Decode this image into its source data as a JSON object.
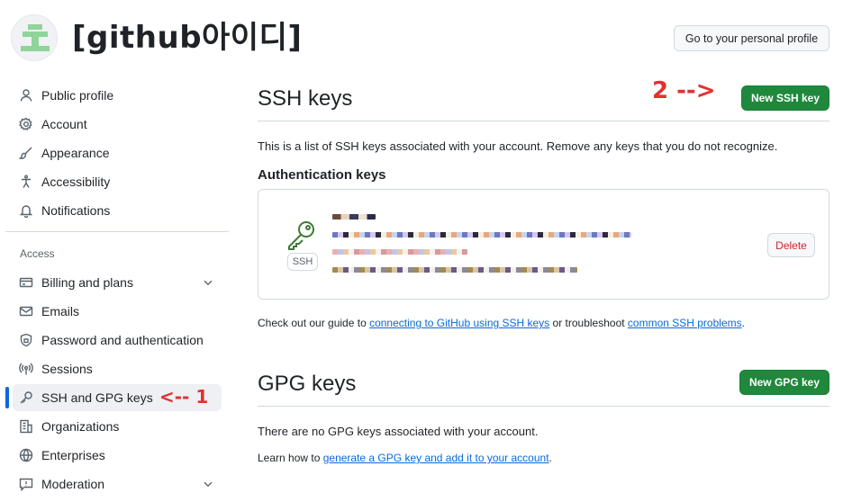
{
  "header": {
    "username": "[github아이디]",
    "profile_button": "Go to your personal profile"
  },
  "sidebar": {
    "section_label": "Access",
    "items": [
      {
        "label": "Public profile",
        "icon": "person-icon"
      },
      {
        "label": "Account",
        "icon": "gear-icon"
      },
      {
        "label": "Appearance",
        "icon": "paintbrush-icon"
      },
      {
        "label": "Accessibility",
        "icon": "accessibility-icon"
      },
      {
        "label": "Notifications",
        "icon": "bell-icon"
      },
      {
        "label": "Billing and plans",
        "icon": "credit-card-icon"
      },
      {
        "label": "Emails",
        "icon": "mail-icon"
      },
      {
        "label": "Password and authentication",
        "icon": "shield-lock-icon"
      },
      {
        "label": "Sessions",
        "icon": "broadcast-icon"
      },
      {
        "label": "SSH and GPG keys",
        "icon": "key-icon"
      },
      {
        "label": "Organizations",
        "icon": "organization-icon"
      },
      {
        "label": "Enterprises",
        "icon": "globe-icon"
      },
      {
        "label": "Moderation",
        "icon": "report-icon"
      }
    ],
    "active_index": 9
  },
  "annotations": {
    "sidebar_arrow": "<-- 1",
    "button_arrow": "2 -->"
  },
  "ssh": {
    "title": "SSH keys",
    "new_button": "New SSH key",
    "description": "This is a list of SSH keys associated with your account. Remove any keys that you do not recognize.",
    "auth_heading": "Authentication keys",
    "key_type_badge": "SSH",
    "delete_button": "Delete",
    "guide_prefix": "Check out our guide to ",
    "guide_link": "connecting to GitHub using SSH keys",
    "guide_middle": " or troubleshoot ",
    "guide_link2": "common SSH problems",
    "guide_suffix": "."
  },
  "gpg": {
    "title": "GPG keys",
    "new_button": "New GPG key",
    "empty_text": "There are no GPG keys associated with your account.",
    "learn_prefix": "Learn how to ",
    "learn_link": "generate a GPG key and add it to your account",
    "learn_suffix": "."
  },
  "colors": {
    "primary_button": "#1f883d",
    "annotation": "#e03131",
    "link": "#0969da",
    "active_indicator": "#0969da",
    "danger": "#d1242f"
  }
}
